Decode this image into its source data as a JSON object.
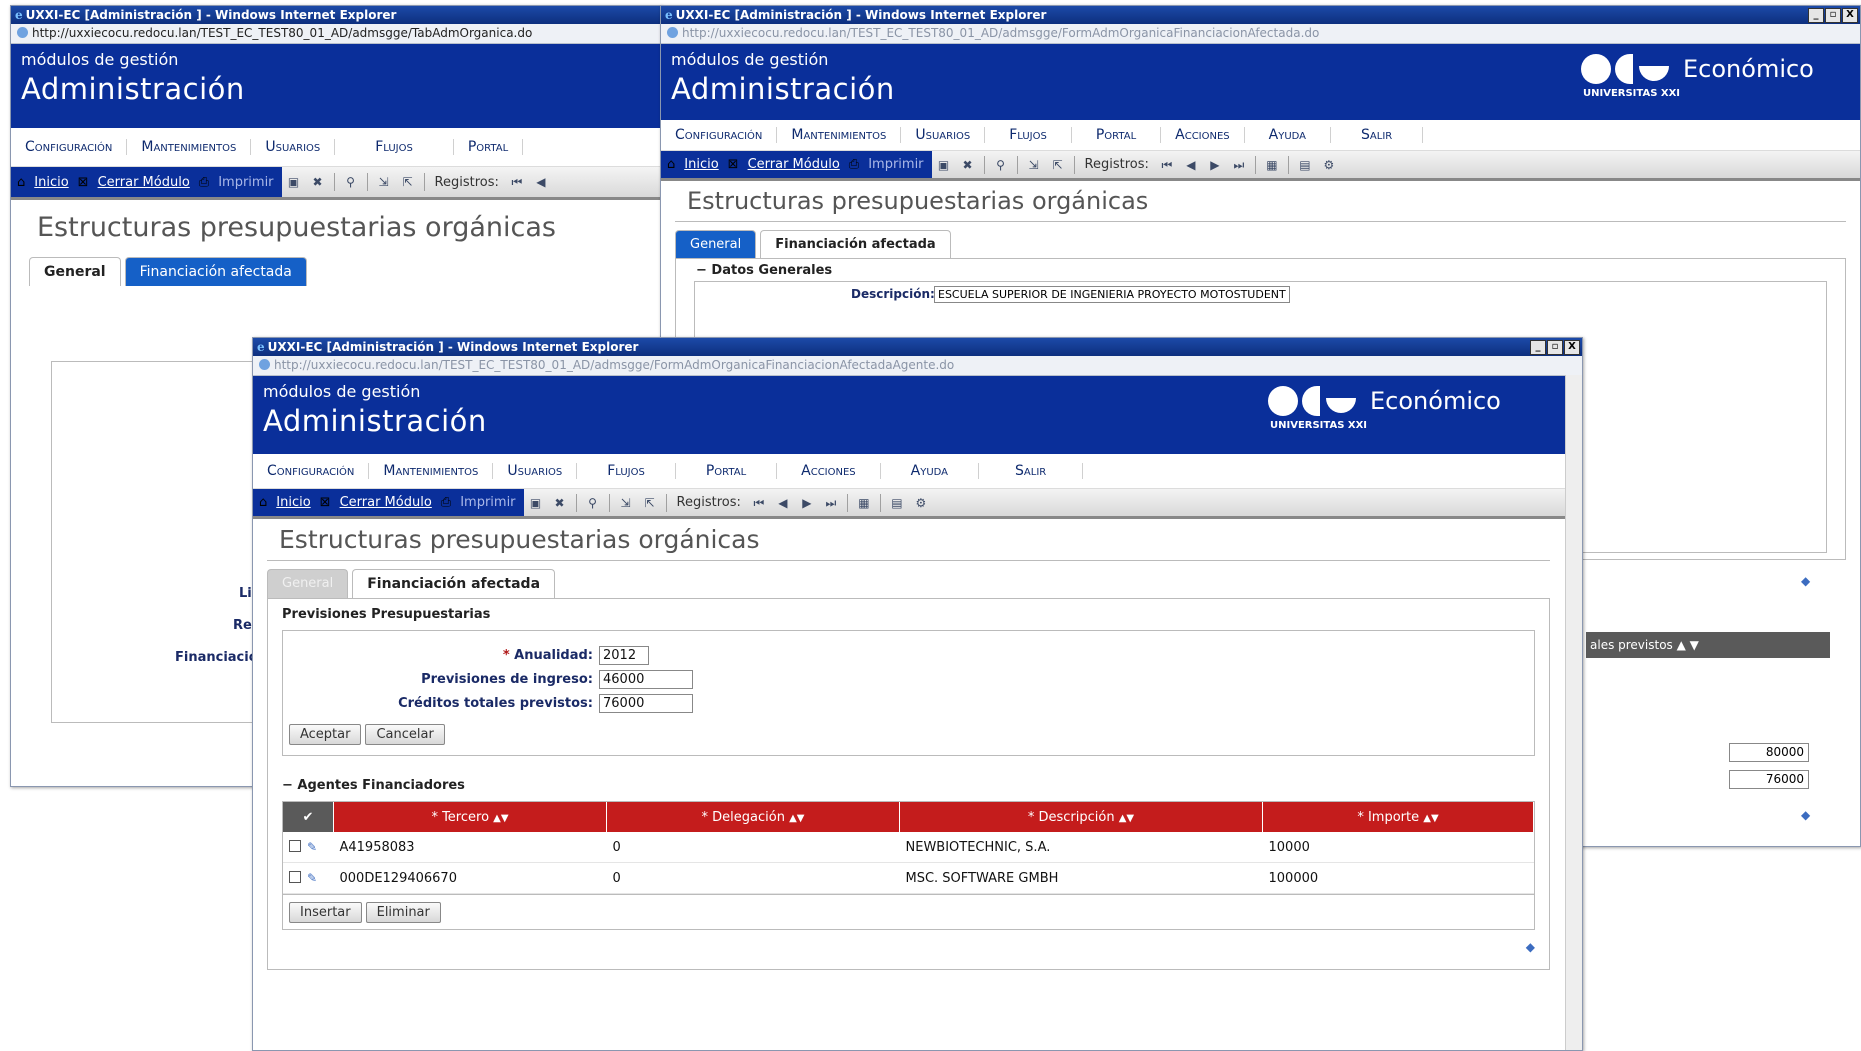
{
  "browser": {
    "title_back": "UXXI-EC [Administración ] - Windows Internet Explorer",
    "title_mid": "UXXI-EC [Administración ] - Windows Internet Explorer",
    "title_front": "UXXI-EC [Administración ] - Windows Internet Explorer",
    "url_back": "http://uxxiecocu.redocu.lan/TEST_EC_TEST80_01_AD/admsgge/TabAdmOrganica.do",
    "url_mid": "http://uxxiecocu.redocu.lan/TEST_EC_TEST80_01_AD/admsgge/FormAdmOrganicaFinanciacionAfectada.do",
    "url_front": "http://uxxiecocu.redocu.lan/TEST_EC_TEST80_01_AD/admsgge/FormAdmOrganicaFinanciacionAfectadaAgente.do",
    "win_buttons": [
      "_",
      "▫",
      "X"
    ]
  },
  "header": {
    "subtitle": "módulos de gestión",
    "title": "Administración",
    "brand": "Económico",
    "university": "UNIVERSITAS XXI"
  },
  "menu": [
    "Configuración",
    "Mantenimientos",
    "Usuarios",
    "Flujos",
    "Portal",
    "Acciones",
    "Ayuda",
    "Salir"
  ],
  "toolbar": {
    "home": "Inicio",
    "close_module": "Cerrar Módulo",
    "print": "Imprimir",
    "records": "Registros:"
  },
  "page": {
    "title": "Estructuras presupuestarias orgánicas",
    "tab_general": "General",
    "tab_financing": "Financiación afectada"
  },
  "mid": {
    "section": "Datos Generales",
    "desc_label": "Descripción:",
    "desc_value": "ESCUELA SUPERIOR DE INGENIERIA PROYECTO MOTOSTUDENT",
    "col_header": "Créditos totales previstos ▲ ▼",
    "col_header_visible": "ales previstos ▲ ▼",
    "value1": "80000",
    "value2": "76000"
  },
  "back": {
    "labels": [
      "Li",
      "Re",
      "Financiació"
    ]
  },
  "form": {
    "section_title": "Previsiones Presupuestarias",
    "anualidad_label": "Anualidad:",
    "anualidad_value": "2012",
    "ingreso_label": "Previsiones de ingreso:",
    "ingreso_value": "46000",
    "creditos_label": "Créditos totales previstos:",
    "creditos_value": "76000",
    "accept": "Aceptar",
    "cancel": "Cancelar"
  },
  "agents": {
    "section_title": "Agentes Financiadores",
    "columns": [
      "Tercero",
      "Delegación",
      "Descripción",
      "Importe"
    ],
    "rows": [
      {
        "tercero": "A41958083",
        "delegacion": "0",
        "descripcion": "NEWBIOTECHNIC, S.A.",
        "importe": "10000"
      },
      {
        "tercero": "000DE129406670",
        "delegacion": "0",
        "descripcion": "MSC. SOFTWARE GMBH",
        "importe": "100000"
      }
    ],
    "insert": "Insertar",
    "delete": "Eliminar"
  },
  "colors": {
    "header_blue": "#0a2f9a",
    "table_red": "#c41c1c",
    "tab_blue": "#1560c7"
  }
}
